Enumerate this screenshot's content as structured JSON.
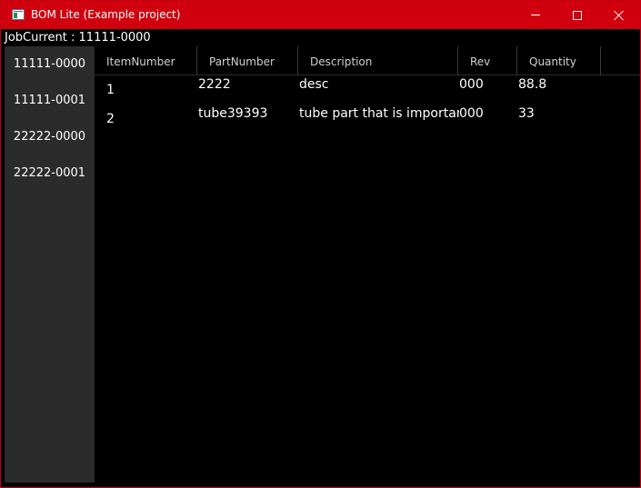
{
  "window": {
    "title": "BOM Lite (Example project)",
    "accent_color": "#d0000e",
    "controls": [
      "minimize-icon",
      "maximize-icon",
      "close-icon"
    ]
  },
  "job": {
    "label": "JobCurrent",
    "value": "11111-0000"
  },
  "sidebar": {
    "items": [
      {
        "label": "11111-0000"
      },
      {
        "label": "11111-0001"
      },
      {
        "label": "22222-0000"
      },
      {
        "label": "22222-0001"
      }
    ]
  },
  "grid": {
    "columns": [
      "ItemNumber",
      "PartNumber",
      "Description",
      "Rev",
      "Quantity"
    ],
    "rows": [
      {
        "item_number": "1",
        "part_number": "2222",
        "description": "desc",
        "rev": "000",
        "quantity": "88.8"
      },
      {
        "item_number": "2",
        "part_number": "tube39393",
        "description": "tube part that is important",
        "rev": "000",
        "quantity": "33"
      }
    ]
  }
}
